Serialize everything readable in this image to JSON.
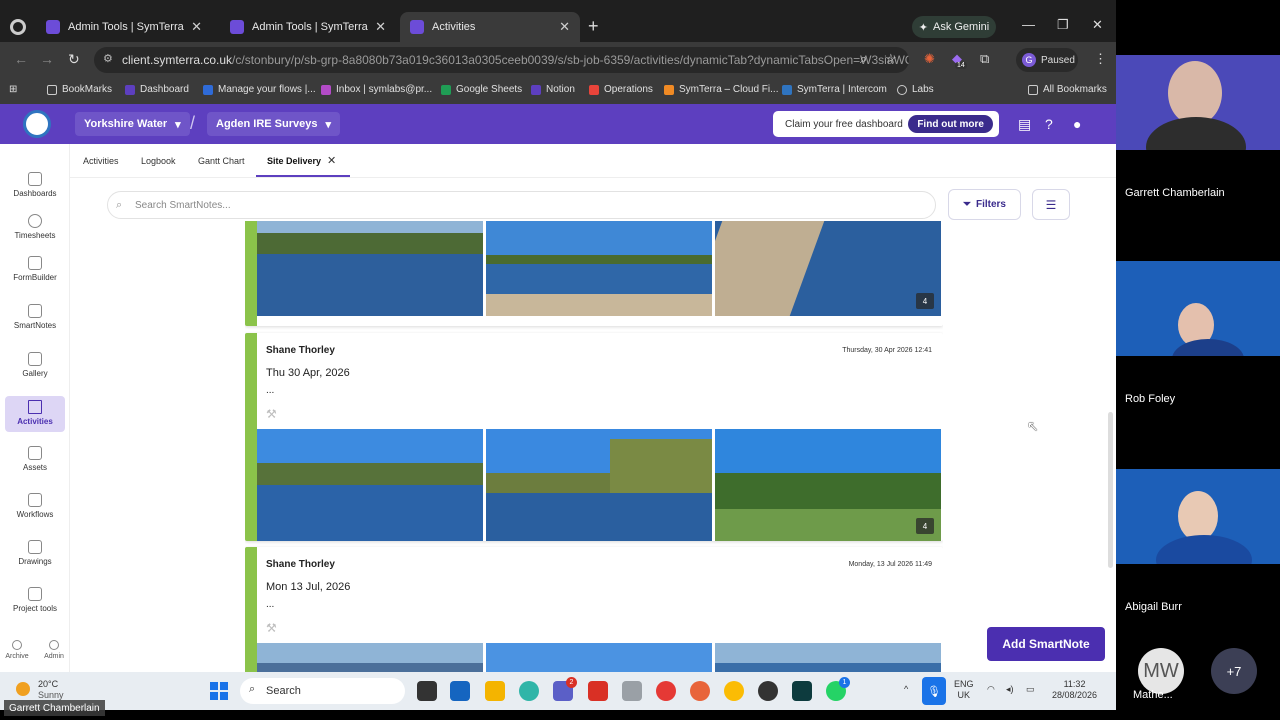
{
  "browser": {
    "tabs": [
      {
        "title": "Admin Tools | SymTerra"
      },
      {
        "title": "Admin Tools | SymTerra"
      },
      {
        "title": "Activities"
      }
    ],
    "gemini_label": "Ask Gemini",
    "url_host": "client.symterra.co.uk",
    "url_path": "/c/stonbury/p/sb-grp-8a8080b73a019c36013a0305ceeb0039/s/sb-job-6359/activities/dynamicTab?dynamicTabsOpen=W3siaWQi...",
    "profile_initial": "G",
    "profile_status": "Paused",
    "ext_badge": "14",
    "bookmarks": [
      {
        "label": "BookMarks"
      },
      {
        "label": "Dashboard"
      },
      {
        "label": "Manage your flows |..."
      },
      {
        "label": "Inbox | symlabs@pr..."
      },
      {
        "label": "Google Sheets"
      },
      {
        "label": "Notion"
      },
      {
        "label": "Operations"
      },
      {
        "label": "SymTerra – Cloud Fi..."
      },
      {
        "label": "SymTerra | Intercom"
      },
      {
        "label": "Labs"
      }
    ],
    "all_bookmarks": "All Bookmarks"
  },
  "app": {
    "org": "Yorkshire Water",
    "project": "Agden IRE Surveys",
    "promo_text": "Claim your free dashboard",
    "promo_cta": "Find out more",
    "sidebar": [
      {
        "label": "Dashboards"
      },
      {
        "label": "Timesheets"
      },
      {
        "label": "FormBuilder"
      },
      {
        "label": "SmartNotes"
      },
      {
        "label": "Gallery"
      },
      {
        "label": "Activities"
      },
      {
        "label": "Assets"
      },
      {
        "label": "Workflows"
      },
      {
        "label": "Drawings"
      },
      {
        "label": "Project tools"
      }
    ],
    "sidebar_bottom": [
      {
        "label": "Archive"
      },
      {
        "label": "Admin"
      }
    ],
    "tabs": [
      {
        "label": "Activities"
      },
      {
        "label": "Logbook"
      },
      {
        "label": "Gantt Chart"
      },
      {
        "label": "Site Delivery"
      }
    ],
    "search_placeholder": "Search SmartNotes...",
    "filters_label": "Filters",
    "add_button": "Add SmartNote",
    "cards": [
      {
        "photo_count": "4"
      },
      {
        "author": "Shane Thorley",
        "timestamp": "Thursday, 30 Apr 2026 12:41",
        "title": "Thu 30 Apr, 2026",
        "body": "...",
        "photo_count": "4"
      },
      {
        "author": "Shane Thorley",
        "timestamp": "Monday, 13 Jul 2026 11:49",
        "title": "Mon 13 Jul, 2026",
        "body": "..."
      }
    ]
  },
  "taskbar": {
    "temp": "20°C",
    "weather": "Sunny",
    "search": "Search",
    "teams_badge": "2",
    "whatsapp_badge": "1",
    "lang": "ENG",
    "region": "UK",
    "time": "11:32",
    "date": "28/08/2026",
    "presenter": "Garrett Chamberlain"
  },
  "meet": {
    "participants": [
      {
        "name": "Garrett Chamberlain"
      },
      {
        "name": "Rob Foley"
      },
      {
        "name": "Abigail Burr"
      },
      {
        "name": "Mathe..."
      }
    ],
    "initials": "MW",
    "more": "+7"
  }
}
